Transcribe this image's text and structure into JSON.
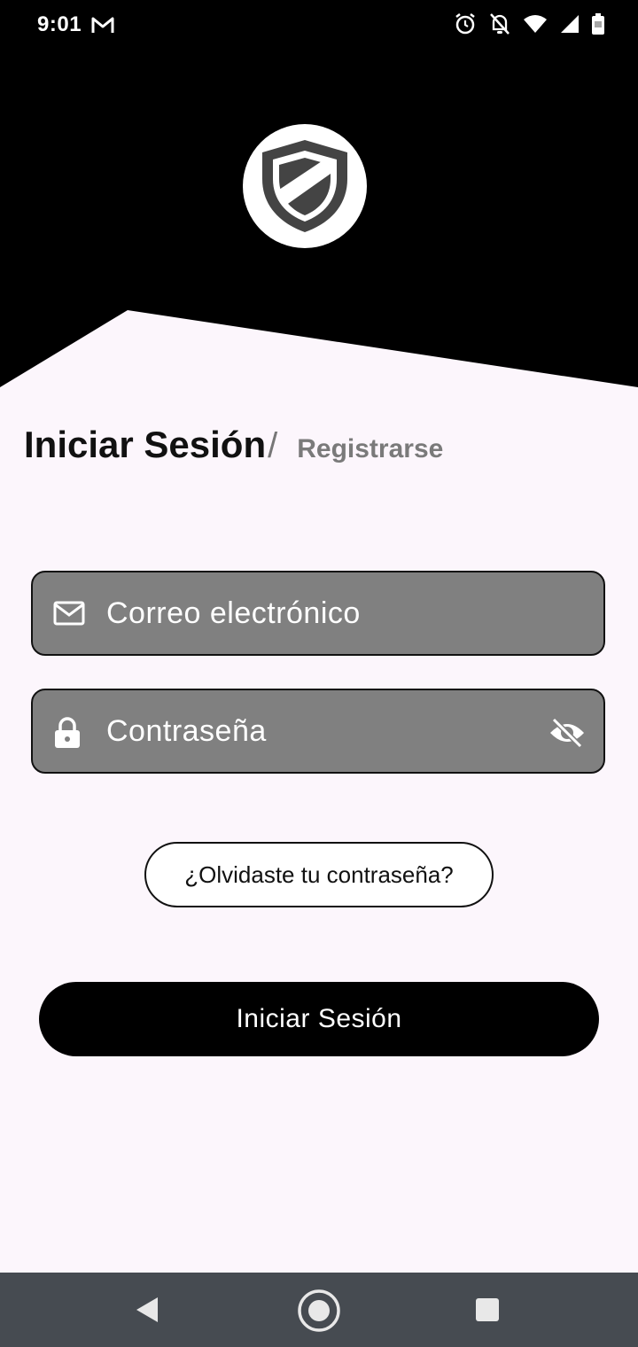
{
  "status_bar": {
    "time": "9:01",
    "icons": [
      "gmail-icon",
      "alarm-icon",
      "notifications-off-icon",
      "wifi-icon",
      "signal-icon",
      "battery-icon"
    ]
  },
  "header": {
    "logo_icon": "shield-icon"
  },
  "tabs": {
    "login_label": "Iniciar Sesión",
    "separator": "/",
    "register_label": "Registrarse"
  },
  "form": {
    "email_placeholder": "Correo electrónico",
    "password_placeholder": "Contraseña",
    "email_icon": "mail-icon",
    "password_icon": "lock-icon",
    "visibility_icon": "visibility-off-icon"
  },
  "forgot_password_label": "¿Olvidaste tu contraseña?",
  "login_button_label": "Iniciar Sesión",
  "navigation": {
    "icons": [
      "back-icon",
      "home-icon",
      "recents-icon"
    ]
  },
  "colors": {
    "header_background": "#000000",
    "page_background": "#fcf6fc",
    "field_background": "#808080",
    "primary_button": "#000000",
    "nav_bar": "#464b51"
  }
}
